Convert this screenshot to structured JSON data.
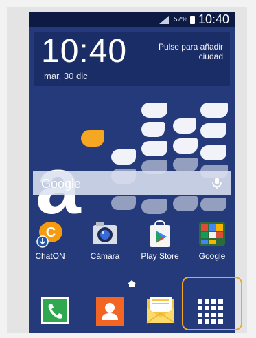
{
  "status_bar": {
    "battery_percent": "57%",
    "time": "10:40"
  },
  "clock_widget": {
    "time": "10:40",
    "date": "mar, 30 dic",
    "city_prompt_line1": "Pulse para añadir",
    "city_prompt_line2": "ciudad"
  },
  "search": {
    "text": "Google"
  },
  "apps": [
    {
      "label": "ChatON",
      "icon": "chaton-icon"
    },
    {
      "label": "Cámara",
      "icon": "camera-icon"
    },
    {
      "label": "Play Store",
      "icon": "play-store-icon"
    },
    {
      "label": "Google",
      "icon": "google-folder-icon"
    }
  ],
  "dock": [
    {
      "name": "phone",
      "icon": "phone-icon"
    },
    {
      "name": "contacts",
      "icon": "contacts-icon"
    },
    {
      "name": "messages",
      "icon": "messages-icon"
    },
    {
      "name": "apps",
      "icon": "apps-grid-icon"
    }
  ],
  "colors": {
    "wallpaper": "#243a7a",
    "accent": "#f5a623"
  }
}
